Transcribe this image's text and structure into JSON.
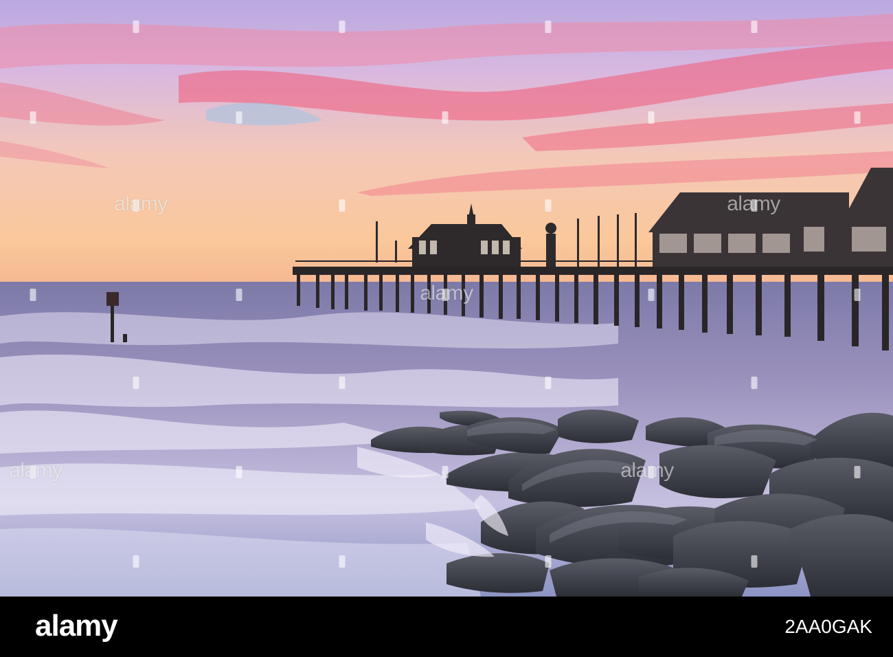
{
  "photo": {
    "subject": "pier-at-sunset",
    "colors": {
      "sky_top": "#c9a0d8",
      "sky_mid": "#f2b8a8",
      "sky_horizon": "#f8c090",
      "cloud_pink": "#f06a8a",
      "sea": "#8a8ab8",
      "foam": "#e8e4f4",
      "rock": "#3a3c44",
      "pier": "#2a2628"
    }
  },
  "watermark": {
    "text": "alamy"
  },
  "footer": {
    "logo": "alamy",
    "image_id": "2AA0GAK"
  }
}
